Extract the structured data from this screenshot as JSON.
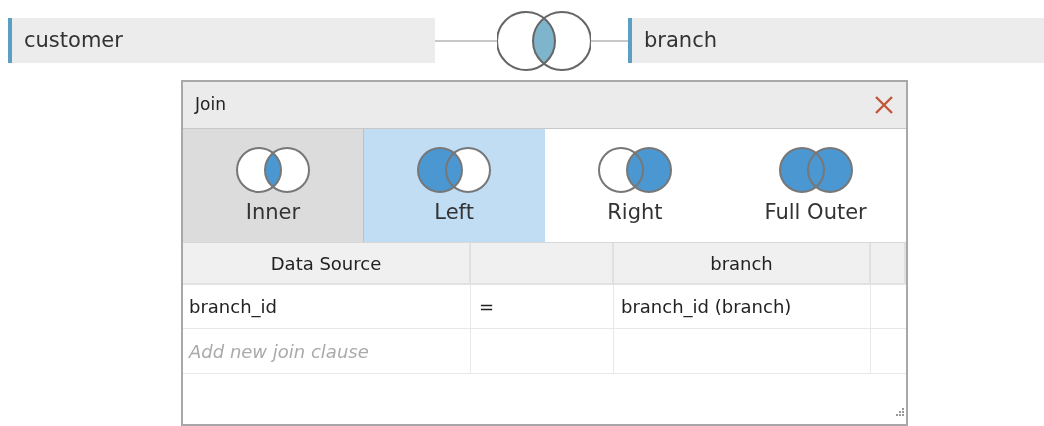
{
  "top": {
    "left_table": "customer",
    "join": {
      "kind": "inner"
    },
    "right_table": "branch"
  },
  "dialog": {
    "title": "Join",
    "join_types": [
      {
        "label": "Inner",
        "kind": "inner",
        "selected": false,
        "hovered": true
      },
      {
        "label": "Left",
        "kind": "left",
        "selected": true,
        "hovered": false
      },
      {
        "label": "Right",
        "kind": "right",
        "selected": false,
        "hovered": false
      },
      {
        "label": "Full Outer",
        "kind": "full",
        "selected": false,
        "hovered": false
      }
    ],
    "columns": [
      "Data Source",
      "branch"
    ],
    "rows": [
      {
        "left": "branch_id",
        "operator": "=",
        "right": "branch_id (branch)"
      }
    ],
    "add_clause_placeholder": "Add new join clause"
  }
}
